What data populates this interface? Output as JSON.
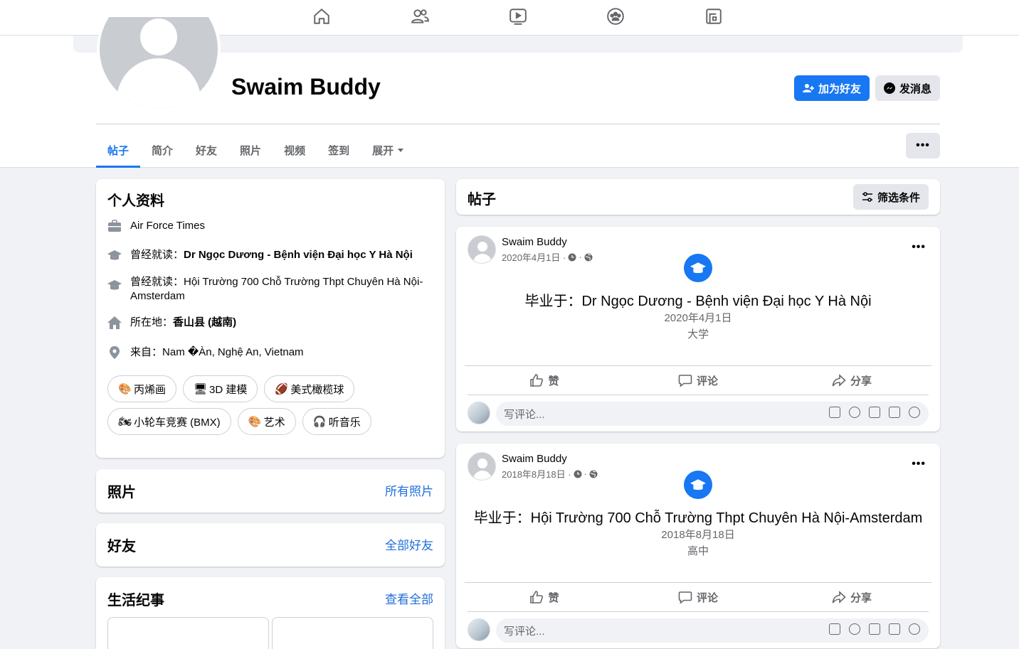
{
  "topnav": {
    "icons": [
      "home-icon",
      "friends-icon",
      "watch-icon",
      "groups-icon",
      "gaming-icon"
    ]
  },
  "profile": {
    "name": "Swaim Buddy",
    "add_friend_label": "加为好友",
    "message_label": "发消息",
    "more_label": "•••",
    "tabs": [
      {
        "label": "帖子"
      },
      {
        "label": "简介"
      },
      {
        "label": "好友"
      },
      {
        "label": "照片"
      },
      {
        "label": "视频"
      },
      {
        "label": "签到"
      },
      {
        "label": "展开"
      }
    ]
  },
  "intro": {
    "title": "个人资料",
    "work": "Air Force Times",
    "edu1_prefix": "曾经就读：",
    "edu1_value": "Dr Ngọc Dương - Bệnh viện Đại học Y Hà Nội",
    "edu2_prefix": "曾经就读：",
    "edu2_value": "Hội Trường 700 Chỗ Trường Thpt Chuyên Hà Nội-Amsterdam",
    "lives_prefix": "所在地：",
    "lives_value": "香山县 (越南)",
    "from_prefix": "来自：",
    "from_value": "Nam �Àn, Nghệ An, Vietnam",
    "hobbies": [
      {
        "emoji": "🎨",
        "label": "丙烯画"
      },
      {
        "emoji": "🖥",
        "label": "3D 建模"
      },
      {
        "emoji": "🏈",
        "label": "美式橄榄球"
      },
      {
        "emoji": "🏍",
        "label": "小轮车竞赛 (BMX)"
      },
      {
        "emoji": "🎨",
        "label": "艺术"
      },
      {
        "emoji": "🎧",
        "label": "听音乐"
      }
    ]
  },
  "photos": {
    "title": "照片",
    "see_all": "所有照片"
  },
  "friends": {
    "title": "好友",
    "see_all": "全部好友"
  },
  "life_events": {
    "title": "生活纪事",
    "see_all": "查看全部"
  },
  "posts_header": {
    "title": "帖子",
    "filter_label": "筛选条件"
  },
  "posts": [
    {
      "author": "Swaim Buddy",
      "date": "2020年4月1日 ·",
      "event_title": "毕业于：Dr Ngọc Dương - Bệnh viện Đại học Y Hà Nội",
      "event_date": "2020年4月1日",
      "event_type": "大学",
      "like": "赞",
      "comment": "评论",
      "share": "分享",
      "comment_placeholder": "写评论..."
    },
    {
      "author": "Swaim Buddy",
      "date": "2018年8月18日 ·",
      "event_title": "毕业于：Hội Trường 700 Chỗ Trường Thpt Chuyên Hà Nội-Amsterdam",
      "event_date": "2018年8月18日",
      "event_type": "高中",
      "like": "赞",
      "comment": "评论",
      "share": "分享",
      "comment_placeholder": "写评论..."
    }
  ],
  "colors": {
    "accent": "#1877f2",
    "background": "#f0f2f5",
    "secondary_text": "#65676b"
  }
}
